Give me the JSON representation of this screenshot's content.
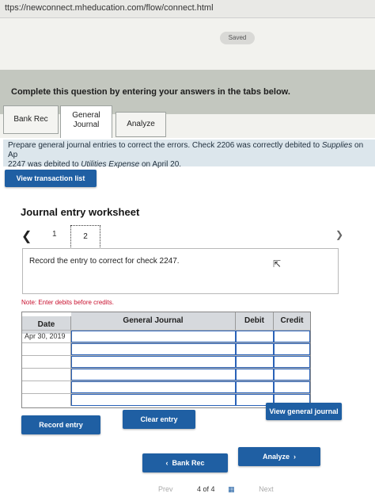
{
  "browser": {
    "url": "ttps://newconnect.mheducation.com/flow/connect.html"
  },
  "status": {
    "saved": "Saved"
  },
  "instructions": "Complete this question by entering your answers in the tabs below.",
  "tabs": [
    {
      "label": "Bank Rec",
      "active": false
    },
    {
      "label": "General Journal",
      "active": true
    },
    {
      "label": "Analyze",
      "active": false
    }
  ],
  "prompt": {
    "line1_start": "Prepare general journal entries to correct the errors. Check 2206 was correctly debited to ",
    "line1_italic": "Supplies",
    "line1_end": " on Ap",
    "line2_start": "2247 was debited to ",
    "line2_italic": "Utilities Expense",
    "line2_end": " on April 20."
  },
  "buttons": {
    "view_transaction_list": "View transaction list",
    "record_entry": "Record entry",
    "clear_entry": "Clear entry",
    "view_general_journal": "View general journal",
    "bank_rec": "Bank Rec",
    "analyze": "Analyze"
  },
  "worksheet": {
    "title": "Journal entry worksheet",
    "pages": [
      "1",
      "2"
    ],
    "current_page": "2",
    "entry_text": "Record the entry to correct for check 2247.",
    "note": "Note: Enter debits before credits."
  },
  "table": {
    "headers": {
      "date": "Date",
      "general_journal": "General Journal",
      "debit": "Debit",
      "credit": "Credit"
    },
    "first_date": "Apr 30, 2019"
  },
  "footer": {
    "prev": "Prev",
    "page_of": "4 of 4",
    "next": "Next"
  },
  "colors": {
    "primary_button": "#1f5fa3",
    "header_bg": "#d6d9dd",
    "note": "#c8102e"
  }
}
